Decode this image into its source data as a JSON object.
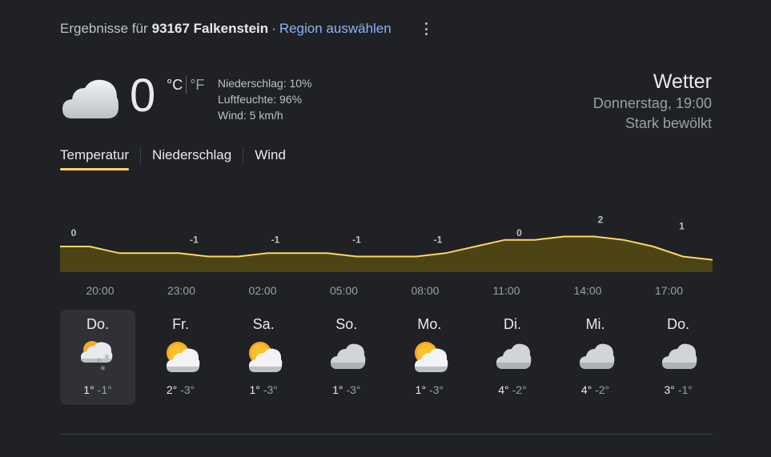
{
  "header": {
    "prefix": "Ergebnisse für",
    "location": "93167 Falkenstein",
    "separator": "·",
    "region_link": "Region auswählen"
  },
  "current": {
    "icon": "cloudy-icon",
    "temp": "0",
    "unit_c": "°C",
    "unit_f": "°F",
    "precipitation": "Niederschlag: 10%",
    "humidity": "Luftfeuchte: 96%",
    "wind": "Wind: 5 km/h"
  },
  "summary": {
    "title": "Wetter",
    "datetime": "Donnerstag, 19:00",
    "condition": "Stark bewölkt"
  },
  "tabs": [
    {
      "label": "Temperatur",
      "active": true
    },
    {
      "label": "Niederschlag",
      "active": false
    },
    {
      "label": "Wind",
      "active": false
    }
  ],
  "chart_data": {
    "type": "area",
    "x": [
      0,
      1,
      2,
      3,
      4,
      5,
      6,
      7
    ],
    "labels": [
      "0",
      "-1",
      "-1",
      "-1",
      "-1",
      "0",
      "2",
      "1"
    ],
    "values": [
      0,
      -1,
      -1,
      -1,
      -1,
      0,
      2,
      1
    ],
    "curve": [
      0,
      0,
      -1,
      -1,
      -1,
      -1.5,
      -1.5,
      -1,
      -1,
      -1,
      -1.5,
      -1.5,
      -1.5,
      -1,
      0,
      1,
      1,
      1.5,
      1.5,
      1,
      0,
      -1.5,
      -2
    ],
    "time_labels": [
      "20:00",
      "23:00",
      "02:00",
      "05:00",
      "08:00",
      "11:00",
      "14:00",
      "17:00"
    ],
    "line_color": "#fdd663",
    "fill_color": "#4d4416"
  },
  "forecast": [
    {
      "day": "Do.",
      "icon": "cloud-snow-icon",
      "hi": "1°",
      "lo": "-1°",
      "selected": true
    },
    {
      "day": "Fr.",
      "icon": "partly-cloudy-icon",
      "hi": "2°",
      "lo": "-3°",
      "selected": false
    },
    {
      "day": "Sa.",
      "icon": "partly-cloudy-icon",
      "hi": "1°",
      "lo": "-3°",
      "selected": false
    },
    {
      "day": "So.",
      "icon": "cloudy-icon",
      "hi": "1°",
      "lo": "-3°",
      "selected": false
    },
    {
      "day": "Mo.",
      "icon": "partly-cloudy-icon",
      "hi": "1°",
      "lo": "-3°",
      "selected": false
    },
    {
      "day": "Di.",
      "icon": "cloudy-icon",
      "hi": "4°",
      "lo": "-2°",
      "selected": false
    },
    {
      "day": "Mi.",
      "icon": "cloudy-icon",
      "hi": "4°",
      "lo": "-2°",
      "selected": false
    },
    {
      "day": "Do.",
      "icon": "cloudy-icon",
      "hi": "3°",
      "lo": "-1°",
      "selected": false
    }
  ]
}
